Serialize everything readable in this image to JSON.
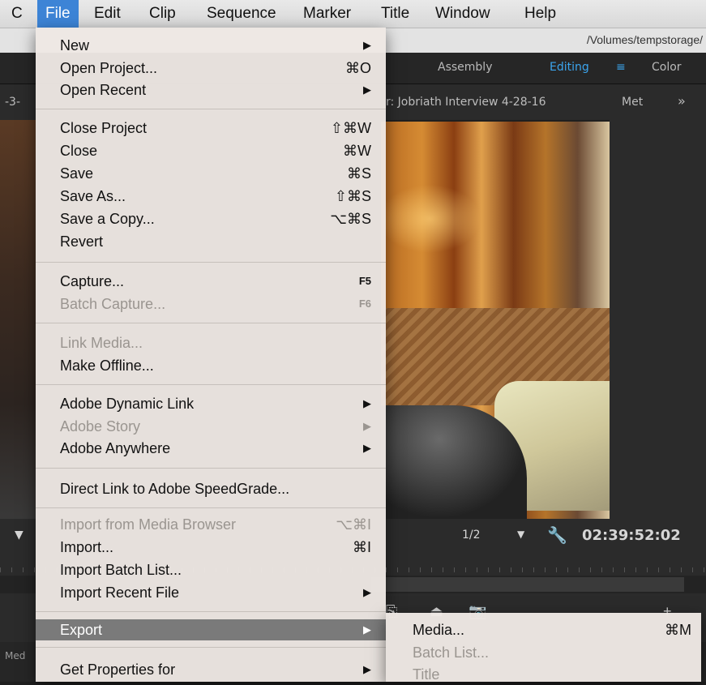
{
  "menubar": {
    "items": [
      "C",
      "File",
      "Edit",
      "Clip",
      "Sequence",
      "Marker",
      "Title",
      "Window",
      "Help"
    ],
    "active": "File"
  },
  "path": "/Volumes/tempstorage/",
  "workspaces": {
    "assembly": "Assembly",
    "editing": "Editing",
    "editing_menu": "≡",
    "color": "Color"
  },
  "panel": {
    "left_tab": "-3-",
    "monitor_title": "r: Jobriath Interview 4-28-16",
    "meta_tab": "Met",
    "more": "»"
  },
  "monitor": {
    "scale": "1/2",
    "timecode": "02:39:52:02"
  },
  "bottom": {
    "media_tab": "Med"
  },
  "file_menu": {
    "new": {
      "label": "New",
      "arrow": "▶"
    },
    "open_project": {
      "label": "Open Project...",
      "shortcut": "⌘O"
    },
    "open_recent": {
      "label": "Open Recent",
      "arrow": "▶"
    },
    "close_project": {
      "label": "Close Project",
      "shortcut": "⇧⌘W"
    },
    "close": {
      "label": "Close",
      "shortcut": "⌘W"
    },
    "save": {
      "label": "Save",
      "shortcut": "⌘S"
    },
    "save_as": {
      "label": "Save As...",
      "shortcut": "⇧⌘S"
    },
    "save_copy": {
      "label": "Save a Copy...",
      "shortcut": "⌥⌘S"
    },
    "revert": {
      "label": "Revert"
    },
    "capture": {
      "label": "Capture...",
      "shortcut": "F5"
    },
    "batch_capture": {
      "label": "Batch Capture...",
      "shortcut": "F6"
    },
    "link_media": {
      "label": "Link Media..."
    },
    "make_offline": {
      "label": "Make Offline..."
    },
    "dynamic_link": {
      "label": "Adobe Dynamic Link",
      "arrow": "▶"
    },
    "adobe_story": {
      "label": "Adobe Story",
      "arrow": "▶"
    },
    "adobe_anywhere": {
      "label": "Adobe Anywhere",
      "arrow": "▶"
    },
    "speedgrade": {
      "label": "Direct Link to Adobe SpeedGrade..."
    },
    "import_media_browser": {
      "label": "Import from Media Browser",
      "shortcut": "⌥⌘I"
    },
    "import": {
      "label": "Import...",
      "shortcut": "⌘I"
    },
    "import_batch": {
      "label": "Import Batch List..."
    },
    "import_recent": {
      "label": "Import Recent File",
      "arrow": "▶"
    },
    "export": {
      "label": "Export",
      "arrow": "▶"
    },
    "get_properties": {
      "label": "Get Properties for",
      "arrow": "▶"
    }
  },
  "export_submenu": {
    "media": {
      "label": "Media...",
      "shortcut": "⌘M"
    },
    "batch_list": {
      "label": "Batch List..."
    },
    "title": {
      "label": "Title"
    }
  },
  "colors": {
    "menu_highlight": "#3d84d6",
    "item_highlight": "#7a7a7a",
    "workspace_active": "#3ba5ee"
  }
}
